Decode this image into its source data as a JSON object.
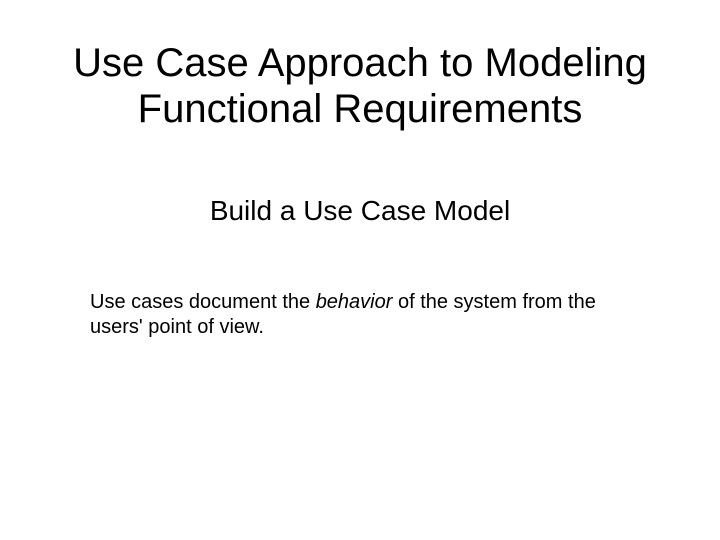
{
  "title_line1": "Use Case Approach to Modeling",
  "title_line2": "Functional Requirements",
  "subtitle": "Build a Use Case Model",
  "body_pre": "Use cases document the ",
  "body_italic": "behavior",
  "body_post": " of the system from the users' point of view."
}
